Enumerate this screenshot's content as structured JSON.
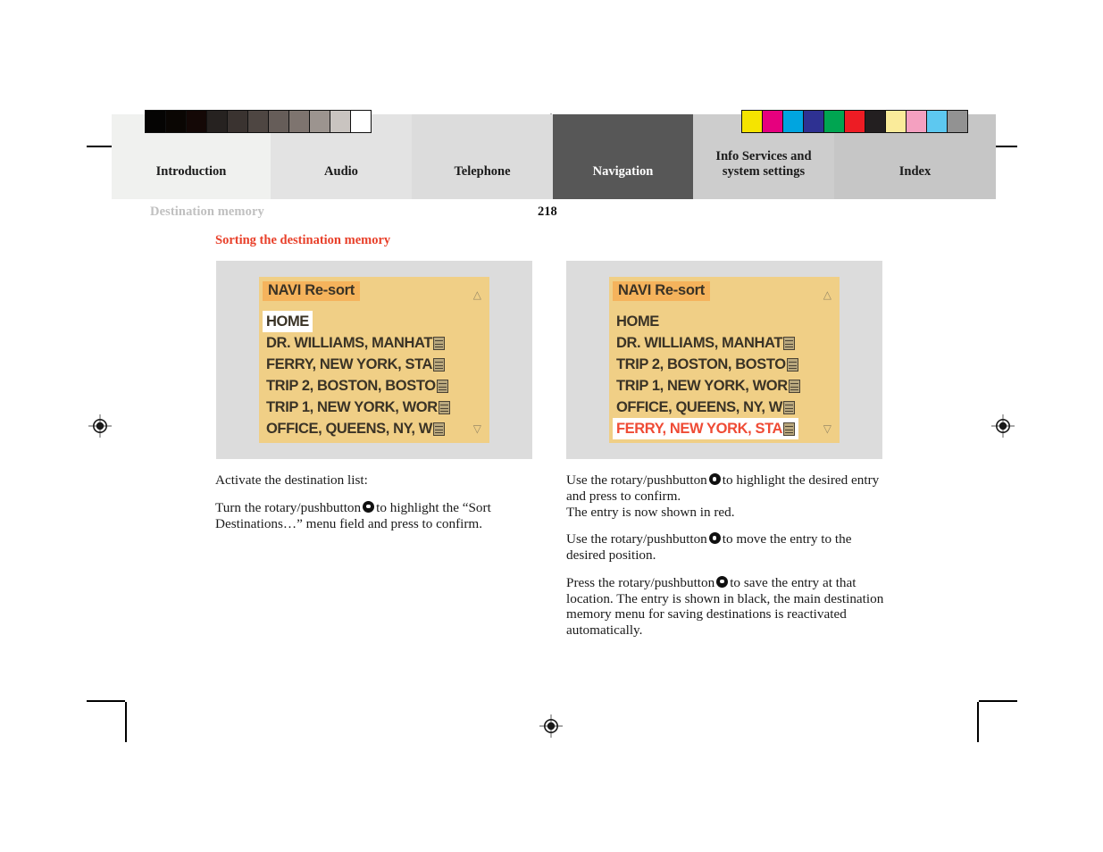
{
  "document": {
    "running_head": "Destination memory",
    "page_number": "218",
    "section_title": "Sorting the destination memory"
  },
  "tabs": [
    {
      "label": "Introduction",
      "active": false,
      "bg": "#f0f1ef"
    },
    {
      "label": "Audio",
      "active": false,
      "bg": "#e3e3e3"
    },
    {
      "label": "Telephone",
      "active": false,
      "bg": "#dcdcdc"
    },
    {
      "label": "Navigation",
      "active": true,
      "bg": "#575757"
    },
    {
      "label": "Info Services and\nsystem settings",
      "active": false,
      "bg": "#cdcdcd"
    },
    {
      "label": "Index",
      "active": false,
      "bg": "#c6c6c6"
    }
  ],
  "swatches": {
    "gray_strip": [
      "#050403",
      "#0a0603",
      "#140806",
      "#262220",
      "#3a3330",
      "#4e4642",
      "#665d59",
      "#7e746f",
      "#9c948f",
      "#c9c4c0",
      "#ffffff"
    ],
    "color_strip": [
      "#f5e400",
      "#e6007e",
      "#00a5e0",
      "#2e3192",
      "#00a551",
      "#ed1c24",
      "#231f20",
      "#faeb9a",
      "#f4a0c0",
      "#5dc8f0",
      "#929292"
    ]
  },
  "screens": {
    "left": {
      "title": "NAVI Re-sort",
      "scroll_up_icon": "scroll-up-arrow",
      "scroll_down_icon": "scroll-down-arrow",
      "rows": [
        {
          "text": "HOME",
          "icon": false,
          "state": "selected-white"
        },
        {
          "text": "DR. WILLIAMS, MANHAT",
          "icon": true,
          "state": "normal"
        },
        {
          "text": "FERRY, NEW YORK, STA",
          "icon": true,
          "state": "normal"
        },
        {
          "text": "TRIP 2, BOSTON, BOSTO",
          "icon": true,
          "state": "normal"
        },
        {
          "text": "TRIP 1, NEW YORK, WOR",
          "icon": true,
          "state": "normal"
        },
        {
          "text": "OFFICE, QUEENS, NY, W",
          "icon": true,
          "state": "normal"
        }
      ]
    },
    "right": {
      "title": "NAVI Re-sort",
      "scroll_up_icon": "scroll-up-arrow",
      "scroll_down_icon": "scroll-down-arrow",
      "rows": [
        {
          "text": "HOME",
          "icon": false,
          "state": "normal"
        },
        {
          "text": "DR. WILLIAMS, MANHAT",
          "icon": true,
          "state": "normal"
        },
        {
          "text": "TRIP 2, BOSTON, BOSTO",
          "icon": true,
          "state": "normal"
        },
        {
          "text": "TRIP 1, NEW YORK, WOR",
          "icon": true,
          "state": "normal"
        },
        {
          "text": "OFFICE, QUEENS, NY, W",
          "icon": true,
          "state": "normal"
        },
        {
          "text": "FERRY, NEW YORK, STA",
          "icon": true,
          "state": "selected-red"
        }
      ]
    }
  },
  "text": {
    "left": {
      "p1": "Activate the destination list:",
      "p2a": "Turn the rotary/pushbutton",
      "p2b": "to highlight the “Sort Destinations…” menu field and press to confirm."
    },
    "right": {
      "p1a": "Use the rotary/pushbutton",
      "p1b": "to highlight the desired entry and press to confirm.",
      "p1c": "The entry is now shown in red.",
      "p2a": "Use the rotary/pushbutton",
      "p2b": "to move the entry to the desired position.",
      "p3a": "Press the rotary/pushbutton",
      "p3b": "to save the entry at that location. The entry is shown in black, the main destination memory menu for saving destinations is reactivated automatically."
    }
  },
  "colors": {
    "accent_red": "#e8402a",
    "screen_bg": "#f0cf86",
    "screen_title_bg": "#f5b35c",
    "figure_bg": "#dcdcdc",
    "entry_red": "#ef4b35"
  }
}
